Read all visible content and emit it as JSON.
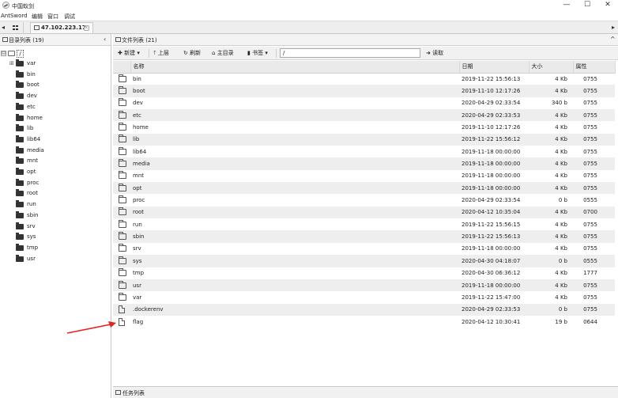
{
  "window": {
    "title": "中国蚁剑",
    "minimize": "—",
    "maximize": "☐",
    "close": "✕"
  },
  "menu": [
    "AntSword",
    "编辑",
    "窗口",
    "调试"
  ],
  "tabs": {
    "left_arrow": "◂",
    "right_arrow": "▸",
    "connection_label": "47.102.223.17",
    "close_label": "x"
  },
  "directory_panel": {
    "title": "目录列表 (19)",
    "collapse": "‹",
    "root_toggle": "⊟",
    "root_label": "/",
    "expand_toggle": "⊞",
    "items": [
      "var",
      "bin",
      "boot",
      "dev",
      "etc",
      "home",
      "lib",
      "lib64",
      "media",
      "mnt",
      "opt",
      "proc",
      "root",
      "run",
      "sbin",
      "srv",
      "sys",
      "tmp",
      "usr"
    ]
  },
  "file_panel": {
    "title": "文件列表 (21)",
    "collapse": "^",
    "toolbar": {
      "new_label": "新建",
      "up_label": "上层",
      "refresh_label": "刷新",
      "home_label": "主目录",
      "bookmark_label": "书签",
      "path_value": "/",
      "read_label": "读取"
    },
    "columns": {
      "name": "名称",
      "date": "日期",
      "size": "大小",
      "perm": "属性"
    },
    "rows": [
      {
        "type": "folder",
        "name": "bin",
        "date": "2019-11-22 15:56:13",
        "size": "4 Kb",
        "perm": "0755"
      },
      {
        "type": "folder",
        "name": "boot",
        "date": "2019-11-10 12:17:26",
        "size": "4 Kb",
        "perm": "0755"
      },
      {
        "type": "folder",
        "name": "dev",
        "date": "2020-04-29 02:33:54",
        "size": "340 b",
        "perm": "0755"
      },
      {
        "type": "folder",
        "name": "etc",
        "date": "2020-04-29 02:33:53",
        "size": "4 Kb",
        "perm": "0755"
      },
      {
        "type": "folder",
        "name": "home",
        "date": "2019-11-10 12:17:26",
        "size": "4 Kb",
        "perm": "0755"
      },
      {
        "type": "folder",
        "name": "lib",
        "date": "2019-11-22 15:56:12",
        "size": "4 Kb",
        "perm": "0755"
      },
      {
        "type": "folder",
        "name": "lib64",
        "date": "2019-11-18 00:00:00",
        "size": "4 Kb",
        "perm": "0755"
      },
      {
        "type": "folder",
        "name": "media",
        "date": "2019-11-18 00:00:00",
        "size": "4 Kb",
        "perm": "0755"
      },
      {
        "type": "folder",
        "name": "mnt",
        "date": "2019-11-18 00:00:00",
        "size": "4 Kb",
        "perm": "0755"
      },
      {
        "type": "folder",
        "name": "opt",
        "date": "2019-11-18 00:00:00",
        "size": "4 Kb",
        "perm": "0755"
      },
      {
        "type": "folder",
        "name": "proc",
        "date": "2020-04-29 02:33:54",
        "size": "0 b",
        "perm": "0555"
      },
      {
        "type": "folder",
        "name": "root",
        "date": "2020-04-12 10:35:04",
        "size": "4 Kb",
        "perm": "0700"
      },
      {
        "type": "folder",
        "name": "run",
        "date": "2019-11-22 15:56:15",
        "size": "4 Kb",
        "perm": "0755"
      },
      {
        "type": "folder",
        "name": "sbin",
        "date": "2019-11-22 15:56:13",
        "size": "4 Kb",
        "perm": "0755"
      },
      {
        "type": "folder",
        "name": "srv",
        "date": "2019-11-18 00:00:00",
        "size": "4 Kb",
        "perm": "0755"
      },
      {
        "type": "folder",
        "name": "sys",
        "date": "2020-04-30 04:18:07",
        "size": "0 b",
        "perm": "0555"
      },
      {
        "type": "folder",
        "name": "tmp",
        "date": "2020-04-30 06:36:12",
        "size": "4 Kb",
        "perm": "1777"
      },
      {
        "type": "folder",
        "name": "usr",
        "date": "2019-11-18 00:00:00",
        "size": "4 Kb",
        "perm": "0755"
      },
      {
        "type": "folder",
        "name": "var",
        "date": "2019-11-22 15:47:00",
        "size": "4 Kb",
        "perm": "0755"
      },
      {
        "type": "file",
        "name": ".dockerenv",
        "date": "2020-04-29 02:33:53",
        "size": "0 b",
        "perm": "0755"
      },
      {
        "type": "file",
        "name": "flag",
        "date": "2020-04-12 10:30:41",
        "size": "19 b",
        "perm": "0644"
      }
    ]
  },
  "task_panel": {
    "title": "任务列表"
  },
  "colors": {
    "annotation": "#e8231f",
    "stripe": "#eeeeee"
  }
}
